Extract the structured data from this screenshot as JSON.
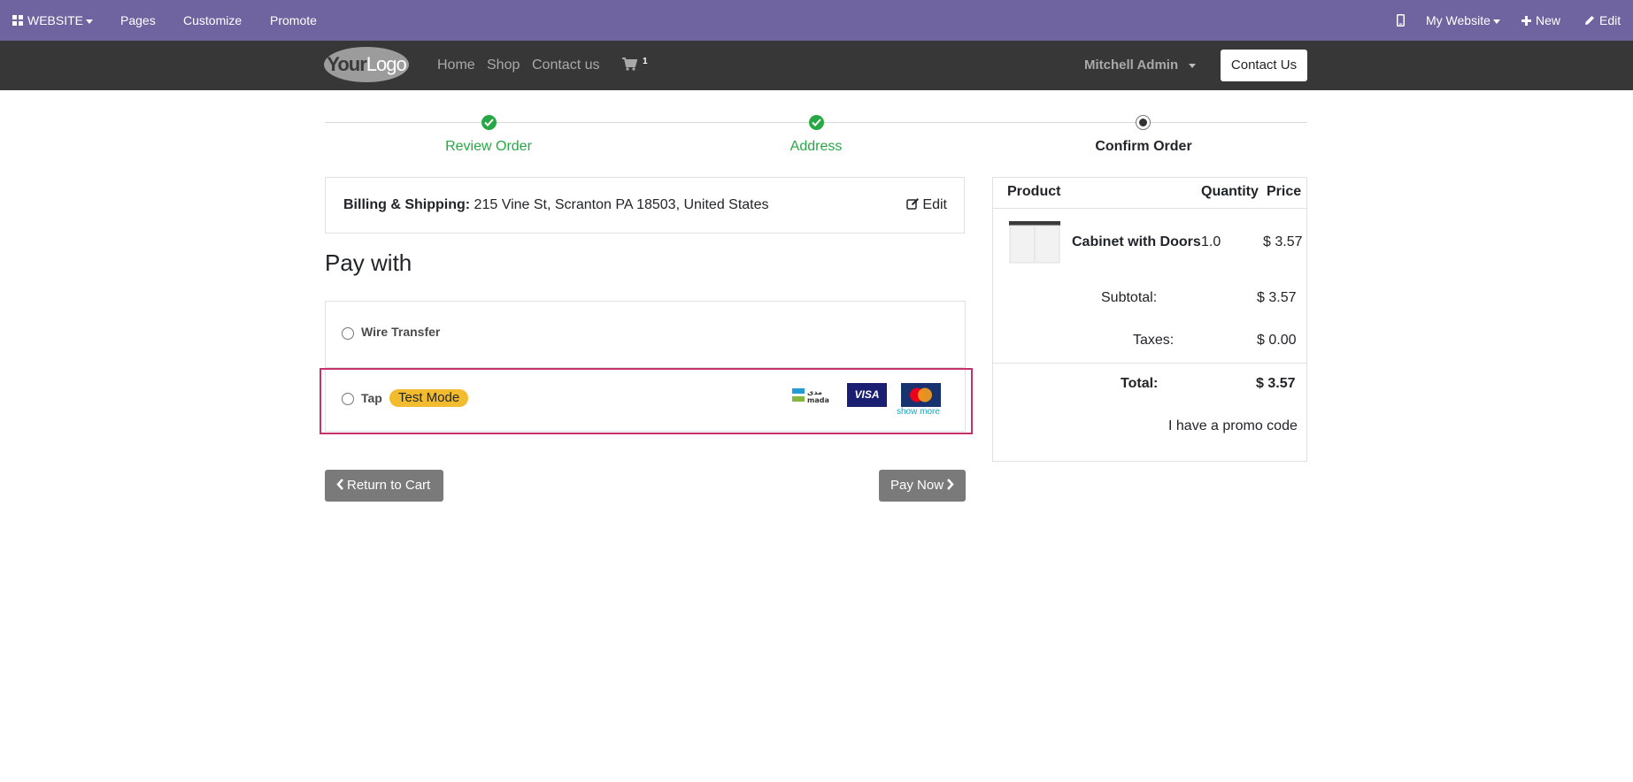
{
  "admin_bar": {
    "website_label": "WEBSITE",
    "pages_label": "Pages",
    "customize_label": "Customize",
    "promote_label": "Promote",
    "my_website_label": "My Website",
    "new_label": "New",
    "edit_label": "Edit"
  },
  "navbar": {
    "logo_text": "YourLogo",
    "logo_bold": "Your",
    "logo_rest": "Logo",
    "links": [
      "Home",
      "Shop",
      "Contact us"
    ],
    "cart_count": "1",
    "user_name": "Mitchell Admin",
    "contact_button": "Contact Us"
  },
  "steps": [
    {
      "label": "Review Order",
      "status": "done"
    },
    {
      "label": "Address",
      "status": "done"
    },
    {
      "label": "Confirm Order",
      "status": "current"
    }
  ],
  "billing": {
    "label": "Billing & Shipping:",
    "address": "215 Vine St, Scranton PA 18503, United States",
    "edit_label": "Edit"
  },
  "payment": {
    "heading": "Pay with",
    "methods": [
      {
        "name": "Wire Transfer"
      },
      {
        "name": "Tap",
        "badge": "Test Mode",
        "icons": [
          "mada-icon",
          "visa-icon",
          "mastercard-icon"
        ],
        "show_more": "show more"
      }
    ],
    "mada_text": "mada",
    "visa_text": "VISA"
  },
  "buttons": {
    "return_to_cart": "Return to Cart",
    "pay_now": "Pay Now"
  },
  "summary": {
    "headers": {
      "product": "Product",
      "quantity": "Quantity",
      "price": "Price"
    },
    "items": [
      {
        "name": "Cabinet with Doors",
        "quantity": "1.0",
        "price": "$ 3.57"
      }
    ],
    "subtotal_label": "Subtotal:",
    "subtotal": "$ 3.57",
    "taxes_label": "Taxes:",
    "taxes": "$ 0.00",
    "total_label": "Total:",
    "total": "$ 3.57",
    "promo_label": "I have a promo code"
  },
  "colors": {
    "admin_bar": "#7064a0",
    "navbar": "#373737",
    "success": "#28a745",
    "highlight": "#c5336a",
    "badge": "#f3bc2e",
    "button_gray": "#7a7a7a"
  }
}
